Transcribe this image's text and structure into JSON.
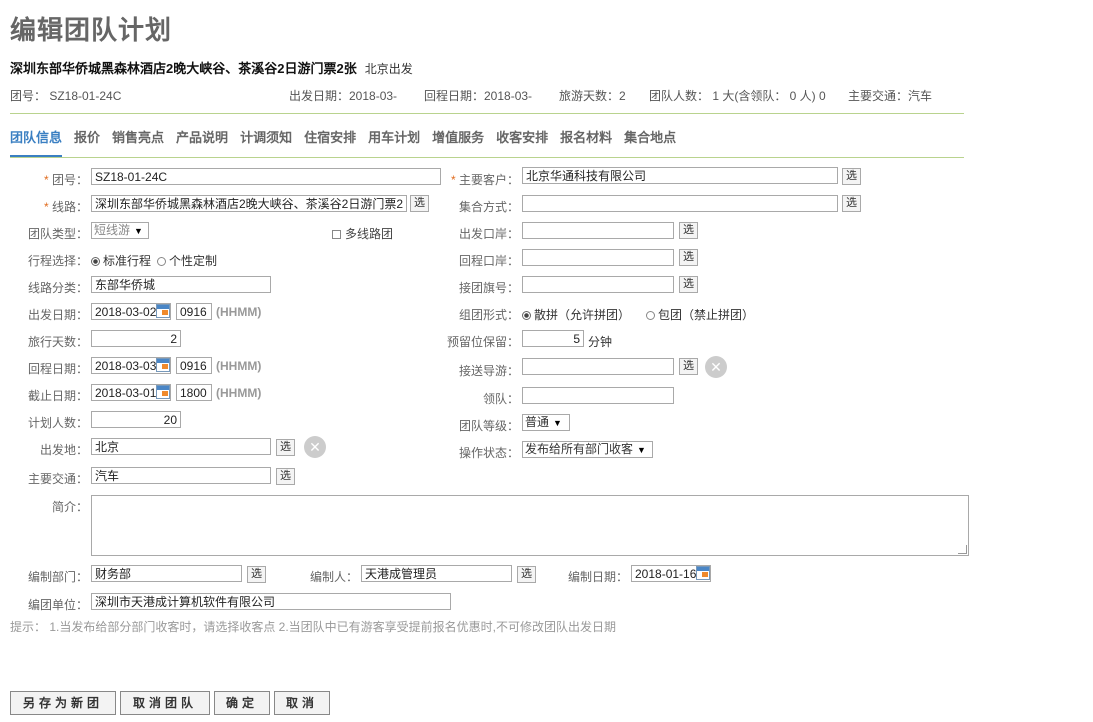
{
  "page_title": "编辑团队计划",
  "route": {
    "name": "深圳东部华侨城黑森林酒店2晚大峡谷、茶溪谷2日游门票2张",
    "origin_tag": "北京出发"
  },
  "summary": {
    "group_no": "团号： SZ18-01-24C",
    "depart": "出发日期：2018-03-",
    "return": "回程日期：2018-03-",
    "days": "旅游天数：2",
    "people": "团队人数： 1 大(含领队： 0 人) 0",
    "transport": "主要交通：汽车"
  },
  "tabs": [
    "团队信息",
    "报价",
    "销售亮点",
    "产品说明",
    "计调须知",
    "住宿安排",
    "用车计划",
    "增值服务",
    "收客安排",
    "报名材料",
    "集合地点"
  ],
  "select_label": "选",
  "left": {
    "group_no": {
      "label": "团号：",
      "value": "SZ18-01-24C"
    },
    "route": {
      "label": "线路：",
      "value": "深圳东部华侨城黑森林酒店2晚大峡谷、茶溪谷2日游门票2张"
    },
    "team_type": {
      "label": "团队类型：",
      "value": "短线游"
    },
    "multi_route": "多线路团",
    "itinerary": {
      "label": "行程选择：",
      "opt1": "标准行程",
      "opt2": "个性定制"
    },
    "route_category": {
      "label": "线路分类：",
      "value": "东部华侨城"
    },
    "depart_date": {
      "label": "出发日期：",
      "value": "2018-03-02",
      "time": "0916",
      "hint": "(HHMM)"
    },
    "travel_days": {
      "label": "旅行天数：",
      "value": "2"
    },
    "return_date": {
      "label": "回程日期：",
      "value": "2018-03-03",
      "time": "0916",
      "hint": "(HHMM)"
    },
    "deadline": {
      "label": "截止日期：",
      "value": "2018-03-01",
      "time": "1800",
      "hint": "(HHMM)"
    },
    "planned_people": {
      "label": "计划人数：",
      "value": "20"
    },
    "depart_place": {
      "label": "出发地：",
      "value": "北京"
    },
    "main_transport": {
      "label": "主要交通：",
      "value": "汽车"
    }
  },
  "right": {
    "main_customer": {
      "label": "主要客户：",
      "value": "北京华通科技有限公司"
    },
    "meet_method": {
      "label": "集合方式：",
      "value": ""
    },
    "depart_port": {
      "label": "出发口岸：",
      "value": ""
    },
    "return_port": {
      "label": "回程口岸：",
      "value": ""
    },
    "flag_no": {
      "label": "接团旗号：",
      "value": ""
    },
    "group_form": {
      "label": "组团形式：",
      "opt1": "散拼（允许拼团）",
      "opt2": "包团（禁止拼团）"
    },
    "reserve": {
      "label": "预留位保留：",
      "value": "5",
      "unit": "分钟"
    },
    "guide": {
      "label": "接送导游：",
      "value": ""
    },
    "leader": {
      "label": "领队：",
      "value": ""
    },
    "level": {
      "label": "团队等级：",
      "value": "普通"
    },
    "op_status": {
      "label": "操作状态：",
      "value": "发布给所有部门收客"
    }
  },
  "intro_label": "简介：",
  "footer": {
    "dept": {
      "label": "编制部门：",
      "value": "财务部"
    },
    "editor": {
      "label": "编制人：",
      "value": "天港成管理员"
    },
    "date": {
      "label": "编制日期：",
      "value": "2018-01-16"
    },
    "unit": {
      "label": "编团单位：",
      "value": "深圳市天港成计算机软件有限公司"
    }
  },
  "tip": "提示： 1.当发布给部分部门收客时，请选择收客点 2.当团队中已有游客享受提前报名优惠时,不可修改团队出发日期",
  "buttons": {
    "save_new": "另存为新团",
    "cancel_group": "取消团队",
    "confirm": "确定",
    "cancel": "取消"
  }
}
